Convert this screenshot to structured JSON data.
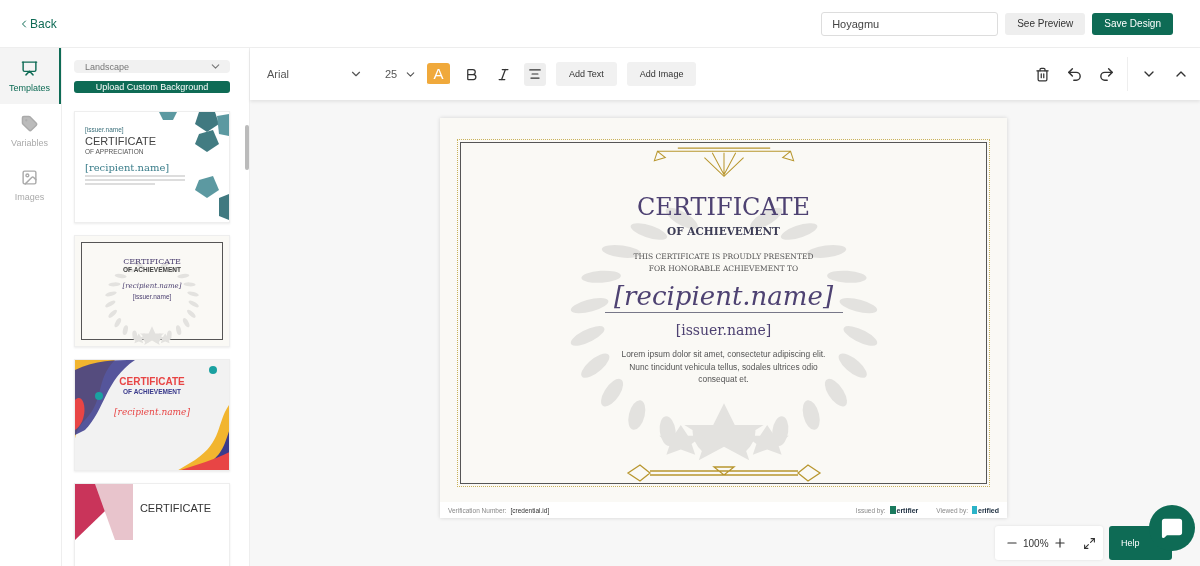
{
  "header": {
    "back": "Back",
    "name_value": "Hoyagmu",
    "preview": "See Preview",
    "save": "Save Design"
  },
  "rail": [
    {
      "label": "Templates",
      "selected": true
    },
    {
      "label": "Variables",
      "selected": false
    },
    {
      "label": "Images",
      "selected": false
    }
  ],
  "panel": {
    "orientation": "Landscape",
    "upload": "Upload Custom Background",
    "templates": [
      {
        "kind": "hex",
        "issuer": "[issuer.name]",
        "title": "CERTIFICATE",
        "subtitle": "OF APPRECIATION",
        "recipient": "[recipient.name]"
      },
      {
        "kind": "laurel",
        "title": "CERTIFICATE",
        "subtitle": "OF ACHIEVEMENT",
        "recipient": "[recipient.name]",
        "issuer": "[issuer.name]"
      },
      {
        "kind": "wave",
        "title": "CERTIFICATE",
        "subtitle": "OF ACHIEVEMENT",
        "recipient": "[recipient.name]"
      },
      {
        "kind": "pink",
        "title": "CERTIFICATE"
      }
    ]
  },
  "toolbar": {
    "font": "Arial",
    "size": "25",
    "highlight_letter": "A",
    "highlight_on": true,
    "add_text": "Add Text",
    "add_image": "Add Image"
  },
  "certificate": {
    "title": "CERTIFICATE",
    "subtitle": "OF ACHIEVEMENT",
    "presented": "THIS CERTIFICATE IS PROUDLY PRESENTED FOR HONORABLE ACHIEVEMENT TO",
    "recipient": "[recipient.name]",
    "issuer": "[issuer.name]",
    "body": "Lorem ipsum dolor sit amet, consectetur adipiscing elit. Nunc tincidunt vehicula tellus, sodales ultrices odio consequat et.",
    "verification_label": "Verification Number:",
    "verification_value": "[credential.id]",
    "issued_by": "Issued by:",
    "issuer_logo": "ertifier",
    "viewed_by": "Viewed by:",
    "viewer_logo": "erified"
  },
  "zoom": {
    "value": "100%"
  },
  "help": "Help"
}
